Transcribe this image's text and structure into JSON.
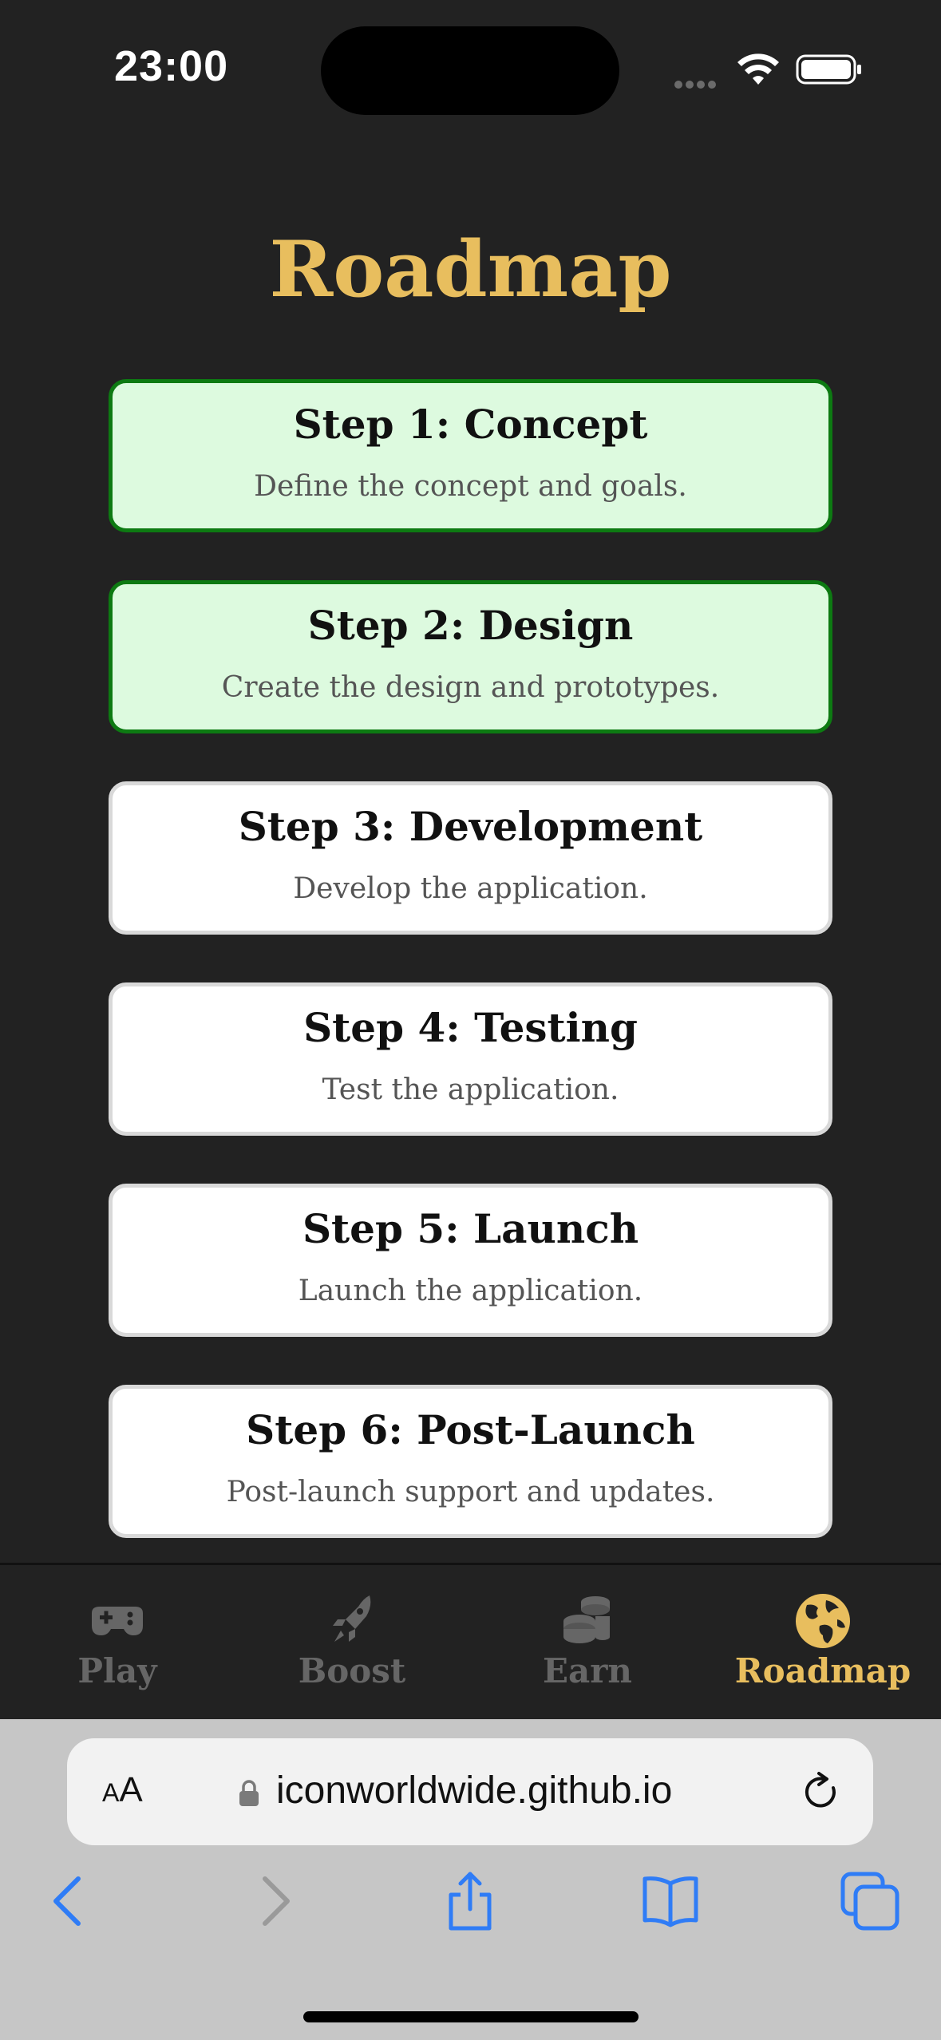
{
  "status_bar": {
    "time": "23:00"
  },
  "page": {
    "title": "Roadmap"
  },
  "steps": [
    {
      "title": "Step 1: Concept",
      "description": "Define the concept and goals.",
      "completed": true
    },
    {
      "title": "Step 2: Design",
      "description": "Create the design and prototypes.",
      "completed": true
    },
    {
      "title": "Step 3: Development",
      "description": "Develop the application.",
      "completed": false
    },
    {
      "title": "Step 4: Testing",
      "description": "Test the application.",
      "completed": false
    },
    {
      "title": "Step 5: Launch",
      "description": "Launch the application.",
      "completed": false
    },
    {
      "title": "Step 6: Post-Launch",
      "description": "Post-launch support and updates.",
      "completed": false
    }
  ],
  "tab_bar": {
    "tabs": [
      {
        "label": "Play",
        "icon": "gamepad-icon",
        "active": false
      },
      {
        "label": "Boost",
        "icon": "rocket-icon",
        "active": false
      },
      {
        "label": "Earn",
        "icon": "coins-icon",
        "active": false
      },
      {
        "label": "Roadmap",
        "icon": "globe-icon",
        "active": true
      }
    ]
  },
  "browser": {
    "text_size_label_small": "A",
    "text_size_label_large": "A",
    "url": "iconworldwide.github.io"
  },
  "colors": {
    "background": "#222222",
    "accent": "#e8be5e",
    "completed_fill": "#ddfadf",
    "completed_border": "#0d7a12",
    "browser_blue": "#2f7cf6"
  }
}
